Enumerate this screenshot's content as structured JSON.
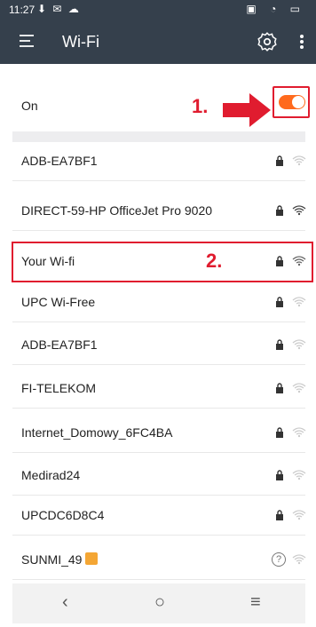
{
  "status_bar": {
    "time": "11:27",
    "left_icons": [
      "download-icon",
      "mail-icon",
      "cloud-icon"
    ],
    "right_icons": [
      "cast-icon",
      "wifi-icon",
      "battery-icon"
    ]
  },
  "app_bar": {
    "title": "Wi-Fi",
    "menu_icon": "menu-icon",
    "settings_icon": "settings-gear-icon",
    "more_icon": "more-vert-icon"
  },
  "toggle_row": {
    "label": "On",
    "state": "on",
    "annotation": "1."
  },
  "annotation_2": "2.",
  "networks": [
    {
      "name": "ADB-EA7BF1",
      "secured": true
    },
    {
      "name": "DIRECT-59-HP OfficeJet Pro 9020",
      "secured": true
    },
    {
      "name": "Your Wi-fi",
      "secured": true
    },
    {
      "name": "UPC Wi-Free",
      "secured": true
    },
    {
      "name": "ADB-EA7BF1",
      "secured": true
    },
    {
      "name": "FI-TELEKOM",
      "secured": true
    },
    {
      "name": "Internet_Domowy_6FC4BA",
      "secured": true
    },
    {
      "name": "Medirad24",
      "secured": true
    },
    {
      "name": "UPCDC6D8C4",
      "secured": true
    },
    {
      "name": "SUNMI_49",
      "secured": false
    }
  ],
  "colors": {
    "app_bar": "#35404c",
    "accent": "#ff6a1d",
    "annotation": "#e01c2f"
  },
  "nav_bar": {
    "back": "‹",
    "home": "○",
    "menu": "≡"
  }
}
